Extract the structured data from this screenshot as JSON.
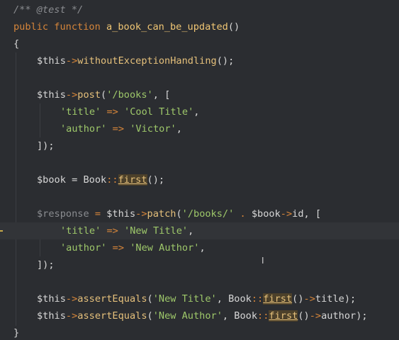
{
  "tokens": {
    "doc_comment": "/** @test */",
    "kw_public": "public",
    "kw_function": "function",
    "fn_name": "a_book_can_be_updated",
    "parens": "()",
    "open_brace": "{",
    "close_brace": "}",
    "this": "$this",
    "arrow": "->",
    "without_exc": "withoutExceptionHandling",
    "call_end": "();",
    "post": "post",
    "open_paren": "(",
    "str_books": "'/books'",
    "comma_bracket": ", [",
    "str_title": "'title'",
    "fat_arrow": "=>",
    "str_cool_title": "'Cool Title'",
    "comma": ",",
    "str_author": "'author'",
    "str_victor": "'Victor'",
    "close_array": "]);",
    "book_var": "$book",
    "equals": "=",
    "book_class": "Book",
    "static_op": "::",
    "first": "first",
    "response_var": "$response",
    "patch": "patch",
    "str_books_slash": "'/books/'",
    "dot": ".",
    "id": "id",
    "str_new_title": "'New Title'",
    "str_new_author": "'New Author'",
    "assert_equals": "assertEquals",
    "title_prop": "title",
    "author_prop": "author",
    "close_call": ");",
    "comma_space": ", ",
    "empty_call": "()"
  },
  "cursor": {
    "ibeam": "I"
  }
}
